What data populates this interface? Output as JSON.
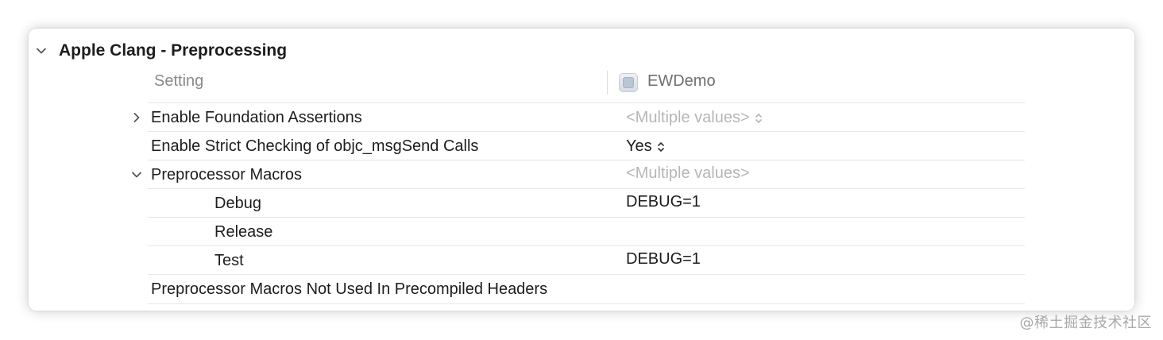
{
  "section": {
    "title": "Apple Clang - Preprocessing"
  },
  "columns": {
    "setting": "Setting",
    "target": "EWDemo",
    "target_icon": "target-app-icon"
  },
  "rows": [
    {
      "label": "Enable Foundation Assertions",
      "value": "<Multiple values>",
      "disclosure": "collapsed",
      "stepper": true,
      "muted": true
    },
    {
      "label": "Enable Strict Checking of objc_msgSend Calls",
      "value": "Yes",
      "stepper": true,
      "muted": false
    },
    {
      "label": "Preprocessor Macros",
      "value": "<Multiple values>",
      "disclosure": "expanded",
      "muted": true
    },
    {
      "label": "Debug",
      "value": "DEBUG=1",
      "indent": true
    },
    {
      "label": "Release",
      "value": "",
      "indent": true
    },
    {
      "label": "Test",
      "value": "DEBUG=1",
      "indent": true
    },
    {
      "label": "Preprocessor Macros Not Used In Precompiled Headers",
      "value": ""
    }
  ],
  "watermark": "@稀土掘金技术社区",
  "colors": {
    "text": "#1d1d1f",
    "muted": "#b6b6ba",
    "header": "#8a8a8e",
    "divider": "#e6e6e6"
  }
}
